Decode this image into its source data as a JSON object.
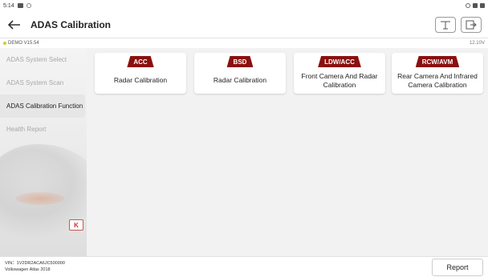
{
  "statusbar": {
    "time": "5:14"
  },
  "header": {
    "title": "ADAS Calibration"
  },
  "version": {
    "label": "DEMO V15.54",
    "voltage": "12.10V"
  },
  "sidebar": {
    "items": [
      {
        "label": "ADAS System Select"
      },
      {
        "label": "ADAS System Scan"
      },
      {
        "label": "ADAS Calibration Function"
      },
      {
        "label": "Health Report"
      }
    ],
    "collapse_label": "K"
  },
  "cards": [
    {
      "badge": "ACC",
      "label": "Radar Calibration"
    },
    {
      "badge": "BSD",
      "label": "Radar Calibration"
    },
    {
      "badge": "LDW/ACC",
      "label": "Front Camera And Radar Calibration"
    },
    {
      "badge": "RCW/AVM",
      "label": "Rear Camera And Infrared Camera Calibration"
    }
  ],
  "footer": {
    "vin": "VIN：1V2DR2ACA6JC500000",
    "vehicle": "Volkswagen Atlas 2018",
    "report_label": "Report"
  },
  "colors": {
    "badge": "#8b0f0f",
    "accent_dot": "#d4c832"
  }
}
